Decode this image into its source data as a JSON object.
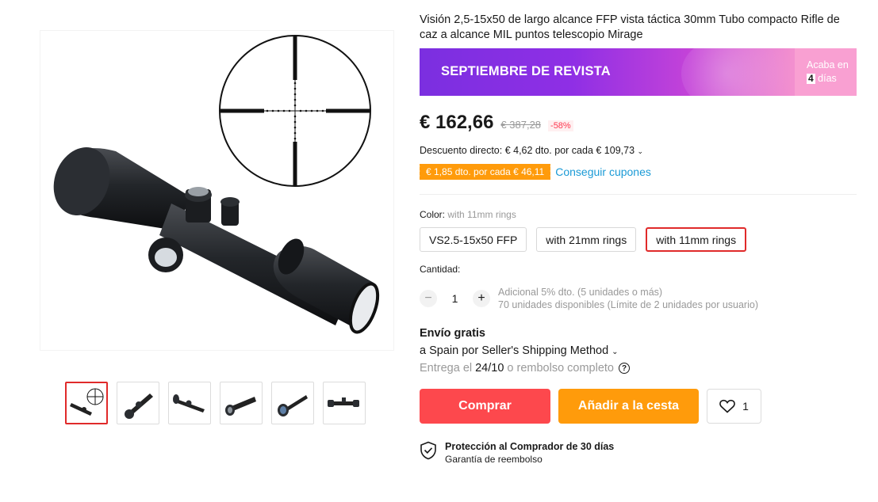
{
  "product": {
    "title": "Visión 2,5-15x50 de largo alcance FFP vista táctica 30mm Tubo compacto Rifle de caz a alcance MIL puntos telescopio Mirage",
    "thumbnails": [
      "scope-reticle",
      "scope-side-1",
      "scope-side-2",
      "scope-front",
      "scope-angle",
      "scope-profile"
    ],
    "active_thumbnail": 0
  },
  "banner": {
    "title": "SEPTIEMBRE DE REVISTA",
    "ends_prefix": "Acaba en",
    "days": "4",
    "days_suffix": "días"
  },
  "pricing": {
    "price": "€ 162,66",
    "old_price": "€ 387,28",
    "discount": "-58%",
    "direct_discount": "Descuento directo: € 4,62 dto. por cada € 109,73",
    "coupon": "€ 1,85 dto. por cada € 46,11",
    "coupon_link": "Conseguir cupones"
  },
  "variants": {
    "label": "Color:",
    "selected_value": "with 11mm rings",
    "options": [
      "VS2.5-15x50 FFP",
      "with 21mm rings",
      "with 11mm rings"
    ],
    "selected_index": 2
  },
  "quantity": {
    "label": "Cantidad:",
    "value": "1",
    "minus": "−",
    "plus": "+",
    "info_line1": "Adicional 5% dto. (5 unidades o más)",
    "info_line2": "70 unidades disponibles (Límite de 2 unidades por usuario)"
  },
  "shipping": {
    "title": "Envío gratis",
    "method": "a Spain por Seller's Shipping Method",
    "delivery_prefix": "Entrega el",
    "delivery_date": "24/10",
    "delivery_suffix": "o rembolso completo",
    "help": "?"
  },
  "actions": {
    "buy": "Comprar",
    "cart": "Añadir a la cesta",
    "wish_count": "1"
  },
  "protection": {
    "title": "Protección al Comprador de 30 días",
    "subtitle": "Garantía de reembolso"
  },
  "colors": {
    "accent_red": "#fd484d",
    "accent_orange": "#ff9b0b",
    "link_blue": "#1a9ad6",
    "selected_border": "#e02a2a"
  }
}
